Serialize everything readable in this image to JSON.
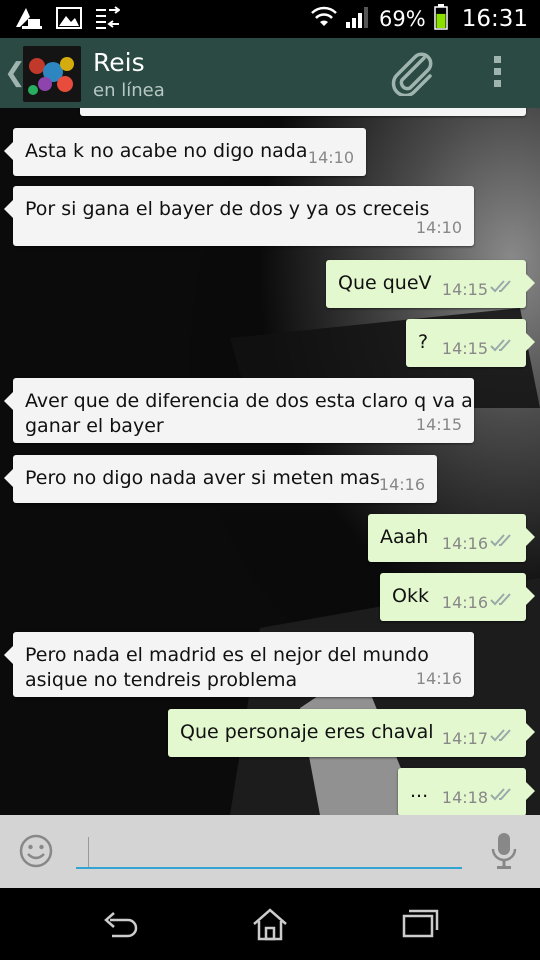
{
  "status_bar": {
    "icons_left": [
      "cleaner-icon",
      "gallery-icon",
      "data-transfer-icon"
    ],
    "wifi_icon": "wifi-icon",
    "signal_icon": "signal-icon",
    "battery_percent": "69%",
    "battery_level": 0.69,
    "time": "16:31"
  },
  "header": {
    "back_icon": "back-chevron-icon",
    "contact_name": "Reis",
    "contact_status": "en línea",
    "attach_icon": "paperclip-icon",
    "menu_icon": "overflow-menu-icon"
  },
  "messages": [
    {
      "dir": "in",
      "lines": [
        "Asta k no acabe no digo nada"
      ],
      "time": "14:10"
    },
    {
      "dir": "in",
      "lines": [
        "Por si gana el bayer de dos y ya os creceis"
      ],
      "time": "14:10"
    },
    {
      "dir": "out",
      "lines": [
        "Que queV"
      ],
      "time": "14:15"
    },
    {
      "dir": "out",
      "lines": [
        "?"
      ],
      "time": "14:15"
    },
    {
      "dir": "in",
      "lines": [
        "Aver que de diferencia de dos esta claro q va a",
        "ganar el bayer"
      ],
      "time": "14:15"
    },
    {
      "dir": "in",
      "lines": [
        "Pero no digo nada aver si meten mas"
      ],
      "time": "14:16"
    },
    {
      "dir": "out",
      "lines": [
        "Aaah"
      ],
      "time": "14:16"
    },
    {
      "dir": "out",
      "lines": [
        "Okk"
      ],
      "time": "14:16"
    },
    {
      "dir": "in",
      "lines": [
        "Pero nada el madrid es el nejor del mundo",
        "asique no tendreis problema"
      ],
      "time": "14:16"
    },
    {
      "dir": "out",
      "lines": [
        "Que personaje eres chaval"
      ],
      "time": "14:17"
    },
    {
      "dir": "out",
      "lines": [
        "..."
      ],
      "time": "14:18"
    }
  ],
  "input_bar": {
    "emoji_icon": "emoji-icon",
    "message_value": "",
    "mic_icon": "microphone-icon"
  },
  "nav_bar": {
    "back": "nav-back-icon",
    "home": "nav-home-icon",
    "recents": "nav-recents-icon"
  },
  "colors": {
    "header_bg": "#2b4a43",
    "incoming_bubble": "#f4f4f4",
    "outgoing_bubble": "#e3f8cf",
    "input_underline": "#33a3d1"
  }
}
